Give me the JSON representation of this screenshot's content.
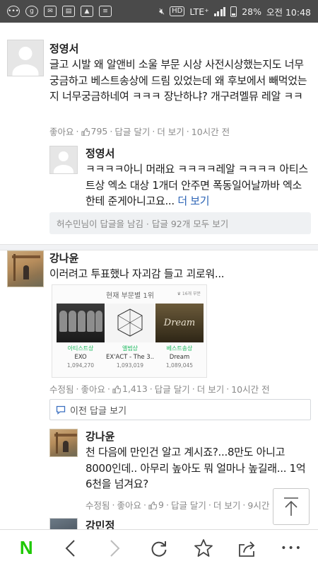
{
  "statusbar": {
    "network": "LTE⁺",
    "battery_pct": "28%",
    "time": "오전 10:48",
    "hd": "HD",
    "icons": [
      "message-icon",
      "g-icon",
      "mail-icon",
      "news-icon",
      "gallery-icon",
      "clipboard-icon",
      "mute-icon",
      "hd-icon",
      "signal-icon",
      "battery-icon"
    ]
  },
  "comments": [
    {
      "author": "정영서",
      "text": "글고 시발 왜 알앤비 소울 부문 시상 사전시상했는지도 너무 궁금하고 베스트송상에 드림 있었는데 왜 후보에서 빼먹었는지 너무궁금하네여 ㅋㅋㅋ 장난하냐? 개구려멜뮤 레알 ㅋㅋ",
      "like": "좋아요",
      "likes": "795",
      "reply": "답글 달기",
      "more": "더 보기",
      "time": "10시간 전",
      "replies": [
        {
          "author": "정영서",
          "text": "ㅋㅋㅋㅋ아니 머래요 ㅋㅋㅋㅋ레알 ㅋㅋㅋㅋ 아티스트상 엑소 대상 1개더 안주면 폭동일어날까바 엑소한테 준게아니고요...",
          "more": "더 보기"
        }
      ],
      "replies_summary": "허수민님이 답글을 남김 · 답글 92개 모두 보기"
    },
    {
      "author": "강나윤",
      "text": "이러려고 투표했나 자괴감 들고 괴로워...",
      "edited": "수정됨",
      "like": "좋아요",
      "likes": "1,413",
      "reply": "답글 달기",
      "more": "더 보기",
      "time": "10시간 전",
      "prev_replies": "이전 답글 보기",
      "award": {
        "title": "현재 부문별 1위",
        "subtitle": "16개 부문",
        "cards": [
          {
            "category": "아티스트상",
            "name": "EXO",
            "votes": "1,094,270"
          },
          {
            "category": "앨범상",
            "name": "EX'ACT - The 3...",
            "votes": "1,093,019"
          },
          {
            "category": "베스트송상",
            "name": "Dream",
            "votes": "1,089,045"
          }
        ],
        "dream_caption": "Dream"
      },
      "replies": [
        {
          "author": "강나윤",
          "text": "천 다음에 만인건 알고 계시죠?...8만도 아니고 8000인데.. 아무리 높아도 뭐 얼마나 높길래... 1억 6천을 넘겨요?",
          "edited": "수정됨",
          "like": "좋아요",
          "likes": "9",
          "reply": "답글 달기",
          "more": "더 보기",
          "time": "9시간"
        }
      ]
    },
    {
      "author": "강민정"
    }
  ],
  "bottom_nav": {
    "logo": "N",
    "items": [
      "back-icon",
      "forward-icon",
      "refresh-icon",
      "star-icon",
      "share-icon",
      "more-icon"
    ],
    "more_glyph": "•••"
  }
}
